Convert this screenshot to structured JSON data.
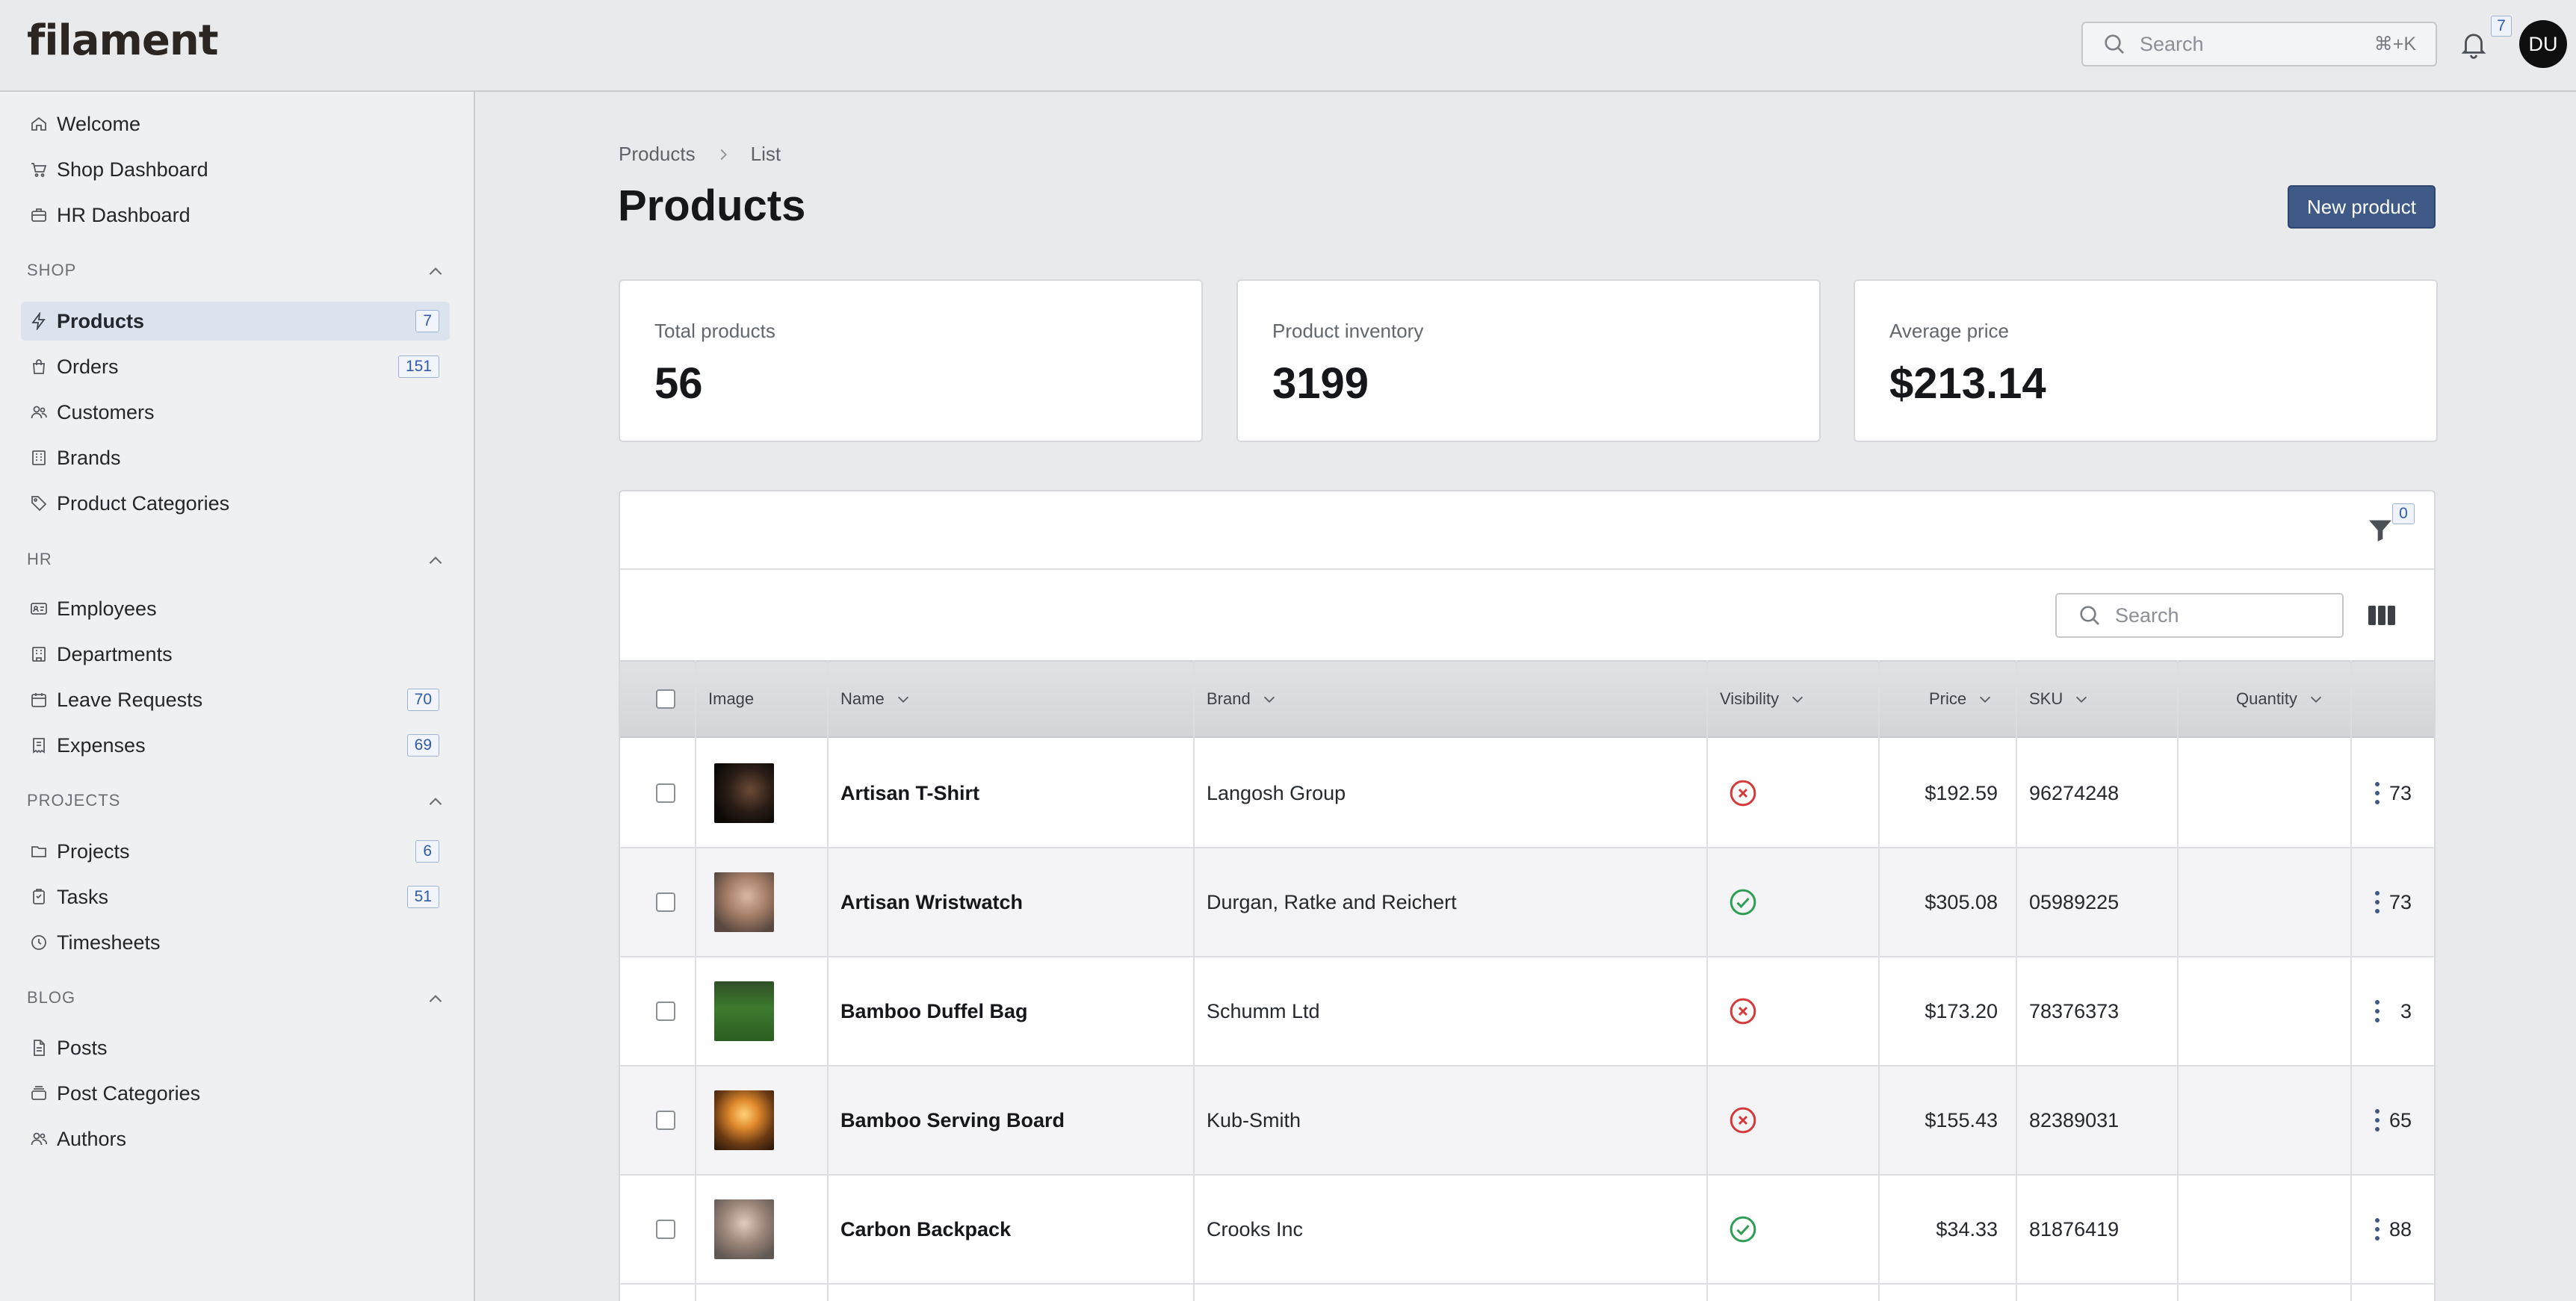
{
  "app": {
    "logo": "filament"
  },
  "topbar": {
    "search_placeholder": "Search",
    "search_shortcut": "⌘+K",
    "notifications_count": "7",
    "avatar_initials": "DU"
  },
  "sidebar": {
    "top_items": [
      {
        "label": "Welcome",
        "icon": "home-icon"
      },
      {
        "label": "Shop Dashboard",
        "icon": "cart-icon"
      },
      {
        "label": "HR Dashboard",
        "icon": "briefcase-icon"
      }
    ],
    "groups": [
      {
        "title": "SHOP",
        "items": [
          {
            "label": "Products",
            "icon": "bolt-icon",
            "badge": "7",
            "active": true
          },
          {
            "label": "Orders",
            "icon": "bag-icon",
            "badge": "151"
          },
          {
            "label": "Customers",
            "icon": "users-icon"
          },
          {
            "label": "Brands",
            "icon": "building-icon"
          },
          {
            "label": "Product Categories",
            "icon": "tag-icon"
          }
        ]
      },
      {
        "title": "HR",
        "items": [
          {
            "label": "Employees",
            "icon": "id-card-icon"
          },
          {
            "label": "Departments",
            "icon": "office-icon"
          },
          {
            "label": "Leave Requests",
            "icon": "calendar-icon",
            "badge": "70"
          },
          {
            "label": "Expenses",
            "icon": "receipt-icon",
            "badge": "69"
          }
        ]
      },
      {
        "title": "PROJECTS",
        "items": [
          {
            "label": "Projects",
            "icon": "folder-icon",
            "badge": "6"
          },
          {
            "label": "Tasks",
            "icon": "clipboard-icon",
            "badge": "51"
          },
          {
            "label": "Timesheets",
            "icon": "clock-icon"
          }
        ]
      },
      {
        "title": "BLOG",
        "items": [
          {
            "label": "Posts",
            "icon": "document-icon"
          },
          {
            "label": "Post Categories",
            "icon": "stack-icon"
          },
          {
            "label": "Authors",
            "icon": "user-group-icon"
          }
        ]
      }
    ]
  },
  "breadcrumb": [
    "Products",
    "List"
  ],
  "page": {
    "title": "Products",
    "new_button": "New product"
  },
  "stats": [
    {
      "label": "Total products",
      "value": "56"
    },
    {
      "label": "Product inventory",
      "value": "3199"
    },
    {
      "label": "Average price",
      "value": "$213.14"
    }
  ],
  "table": {
    "filter_count": "0",
    "search_placeholder": "Search",
    "columns": [
      "Image",
      "Name",
      "Brand",
      "Visibility",
      "Price",
      "SKU",
      "Quantity"
    ],
    "rows": [
      {
        "name": "Artisan T-Shirt",
        "brand": "Langosh Group",
        "visible": false,
        "price": "$192.59",
        "sku": "96274248",
        "quantity": "73",
        "image": "dark-portrait"
      },
      {
        "name": "Artisan Wristwatch",
        "brand": "Durgan, Ratke and Reichert",
        "visible": true,
        "price": "$305.08",
        "sku": "05989225",
        "quantity": "73",
        "image": "person-photo"
      },
      {
        "name": "Bamboo Duffel Bag",
        "brand": "Schumm Ltd",
        "visible": false,
        "price": "$173.20",
        "sku": "78376373",
        "quantity": "3",
        "image": "green-field"
      },
      {
        "name": "Bamboo Serving Board",
        "brand": "Kub-Smith",
        "visible": false,
        "price": "$155.43",
        "sku": "82389031",
        "quantity": "65",
        "image": "sunset-silhouette"
      },
      {
        "name": "Carbon Backpack",
        "brand": "Crooks Inc",
        "visible": true,
        "price": "$34.33",
        "sku": "81876419",
        "quantity": "88",
        "image": "person-photo-2"
      }
    ]
  },
  "colors": {
    "accent": "#3f5a86",
    "visible_ok": "#2f9e55",
    "visible_no": "#d33a3a",
    "badge_text": "#2f5aa8"
  }
}
